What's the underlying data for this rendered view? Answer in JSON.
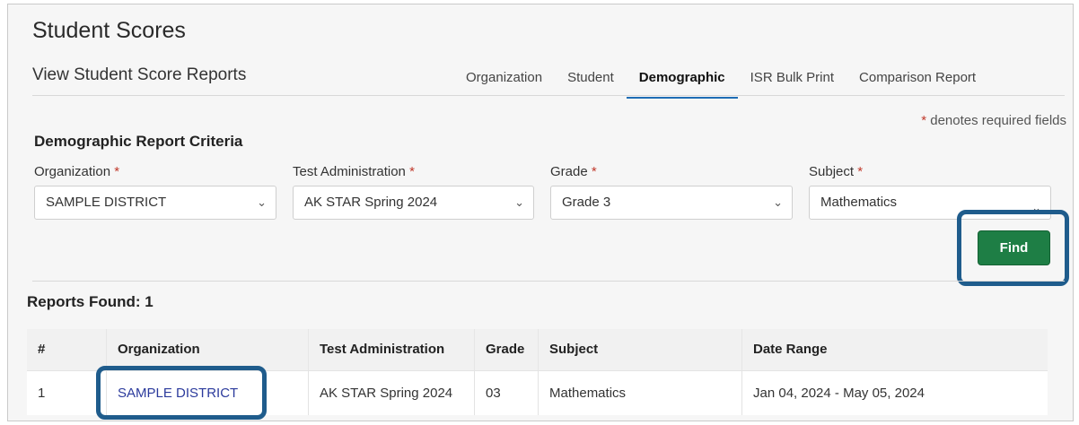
{
  "header": {
    "title": "Student Scores",
    "subtitle": "View Student Score Reports"
  },
  "tabs": [
    {
      "label": "Organization",
      "active": false
    },
    {
      "label": "Student",
      "active": false
    },
    {
      "label": "Demographic",
      "active": true
    },
    {
      "label": "ISR Bulk Print",
      "active": false
    },
    {
      "label": "Comparison Report",
      "active": false
    }
  ],
  "required_note": {
    "star": "*",
    "text": " denotes required fields"
  },
  "criteria": {
    "title": "Demographic Report Criteria",
    "fields": [
      {
        "label": "Organization",
        "value": "SAMPLE DISTRICT"
      },
      {
        "label": "Test Administration",
        "value": "AK STAR Spring 2024"
      },
      {
        "label": "Grade",
        "value": "Grade 3"
      },
      {
        "label": "Subject",
        "value": "Mathematics"
      }
    ],
    "find_label": "Find"
  },
  "results": {
    "label": "Reports Found: 1",
    "columns": [
      "#",
      "Organization",
      "Test Administration",
      "Grade",
      "Subject",
      "Date Range"
    ],
    "rows": [
      [
        "1",
        "SAMPLE DISTRICT",
        "AK STAR Spring 2024",
        "03",
        "Mathematics",
        "Jan 04, 2024 - May 05, 2024"
      ]
    ]
  },
  "colors": {
    "accent_tab_underline": "#1e6db5",
    "find_button": "#1e7e45",
    "highlight_outline": "#1f5c8c",
    "required_star": "#c0392b",
    "link": "#2b3a9c"
  },
  "icons": {
    "select_chevron": "chevron-down-icon"
  }
}
